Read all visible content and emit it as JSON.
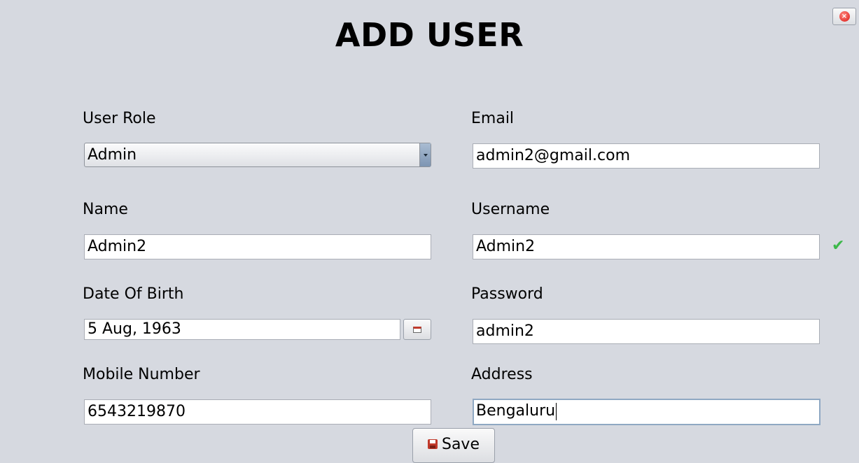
{
  "title": "ADD USER",
  "form": {
    "user_role": {
      "label": "User Role",
      "value": "Admin"
    },
    "email": {
      "label": "Email",
      "value": "admin2@gmail.com"
    },
    "name": {
      "label": "Name",
      "value": "Admin2"
    },
    "username": {
      "label": "Username",
      "value": "Admin2",
      "valid": true
    },
    "date_of_birth": {
      "label": "Date Of Birth",
      "value": "5 Aug, 1963"
    },
    "password": {
      "label": "Password",
      "value": "admin2"
    },
    "mobile_number": {
      "label": "Mobile Number",
      "value": "6543219870"
    },
    "address": {
      "label": "Address",
      "value": "Bengaluru"
    }
  },
  "buttons": {
    "save_label": "Save"
  },
  "icons": {
    "close": "close-icon",
    "calendar": "calendar-icon",
    "check": "checkmark-icon",
    "save": "floppy-disk-icon"
  },
  "colors": {
    "background": "#d6d9e0",
    "valid_check": "#3cb84a",
    "close_red": "#e53935",
    "focus_border": "#8fa8c3"
  }
}
